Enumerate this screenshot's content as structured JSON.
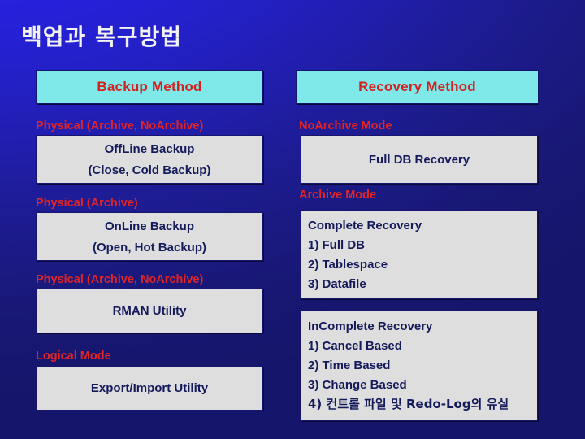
{
  "slide": {
    "title": "백업과 복구방법",
    "colors": {
      "background_top": "#2a22e6",
      "background_bottom": "#15166b",
      "header_box": "#7fe8e8",
      "header_text": "#d52020",
      "label_red": "#e22424",
      "box_fill": "#dedede",
      "box_text": "#141a5a",
      "title_text": "#f2f2f2"
    }
  },
  "columns": {
    "backup": {
      "header": "Backup Method",
      "groups": [
        {
          "label": "Physical (Archive, NoArchive)",
          "lines": [
            "OffLine Backup",
            "(Close, Cold Backup)"
          ]
        },
        {
          "label": "Physical (Archive)",
          "lines": [
            "OnLine Backup",
            "(Open, Hot Backup)"
          ]
        },
        {
          "label": "Physical (Archive, NoArchive)",
          "lines": [
            "RMAN Utility"
          ]
        },
        {
          "label": "Logical Mode",
          "lines": [
            "Export/Import Utility"
          ]
        }
      ]
    },
    "recovery": {
      "header": "Recovery Method",
      "groups": [
        {
          "label": "NoArchive Mode",
          "lines": [
            "Full DB Recovery"
          ]
        },
        {
          "label": "Archive Mode",
          "lines": [
            "Complete Recovery",
            "1) Full DB",
            "2) Tablespace",
            "3) Datafile"
          ]
        },
        {
          "label": "",
          "lines": [
            "InComplete Recovery",
            "1) Cancel Based",
            "2) Time Based",
            "3) Change Based",
            "4) 컨트롤 파일 및 Redo-Log의 유실"
          ]
        }
      ]
    }
  }
}
